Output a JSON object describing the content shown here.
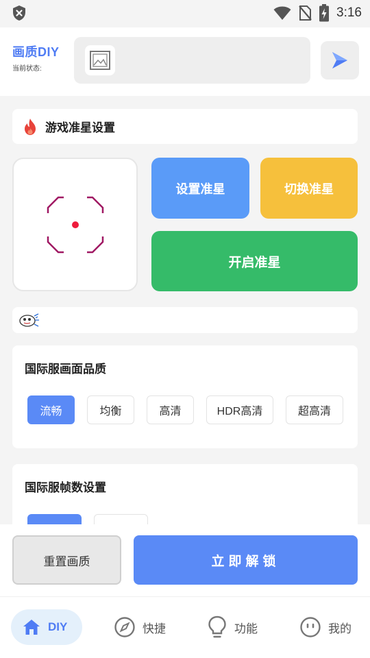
{
  "status_bar": {
    "time": "3:16"
  },
  "header": {
    "brand": "画质DIY",
    "status_label": "当前状态:"
  },
  "crosshair_section": {
    "title": "游戏准星设置",
    "set_label": "设置准星",
    "switch_label": "切换准星",
    "open_label": "开启准星"
  },
  "quality_section": {
    "title": "国际服画面品质",
    "options": [
      "流畅",
      "均衡",
      "高清",
      "HDR高清",
      "超高清"
    ],
    "selected": "流畅"
  },
  "fps_section": {
    "title": "国际服帧数设置"
  },
  "actions": {
    "reset_label": "重置画质",
    "unlock_label": "立即解锁"
  },
  "nav": {
    "items": [
      {
        "label": "DIY",
        "icon": "home-icon"
      },
      {
        "label": "快捷",
        "icon": "compass-icon"
      },
      {
        "label": "功能",
        "icon": "bulb-icon"
      },
      {
        "label": "我的",
        "icon": "face-icon"
      }
    ],
    "active": "DIY"
  },
  "colors": {
    "accent": "#5a8af6",
    "set_button": "#5a9bf8",
    "switch_button": "#f6c03c",
    "open_button": "#35bb69",
    "crosshair": "#a01863"
  }
}
